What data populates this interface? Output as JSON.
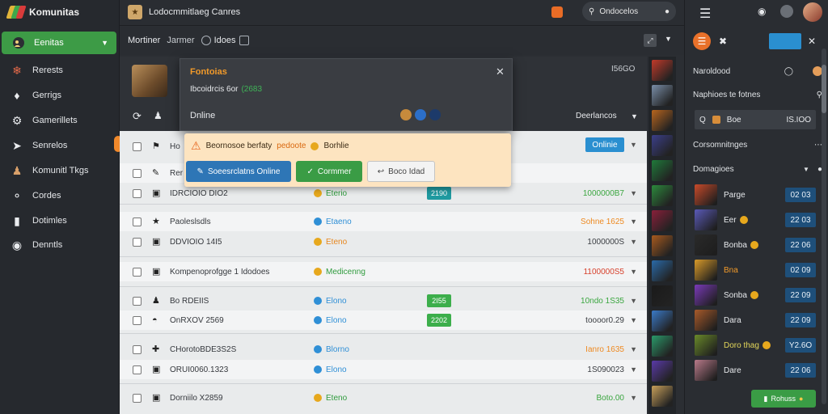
{
  "app": {
    "title": "Komunitas"
  },
  "colors": {
    "accent": "#3d9b46",
    "warning": "#f1892b",
    "link": "#2f8fd6",
    "badge": "#1e4f7a"
  },
  "sidebar": {
    "items": [
      {
        "label": "Eenitas",
        "icon": "games-icon",
        "active": true
      },
      {
        "label": "Rerests",
        "icon": "spark-icon"
      },
      {
        "label": "Gerrigs",
        "icon": "puzzle-icon"
      },
      {
        "label": "Gamerillets",
        "icon": "gear-icon"
      },
      {
        "label": "Senrelos",
        "icon": "rocket-icon"
      },
      {
        "label": "Komunitl Tkgs",
        "icon": "people-icon"
      },
      {
        "label": "Cordes",
        "icon": "link-icon"
      },
      {
        "label": "Dotimles",
        "icon": "chart-icon"
      },
      {
        "label": "Denntls",
        "icon": "discord-icon"
      }
    ]
  },
  "topbar": {
    "title": "Lodocmmitlaeg Canres",
    "search_value": "Ondocelos"
  },
  "subbar": {
    "title": "Mortiner",
    "tab1": "Jarmer",
    "tab2": "Idoes"
  },
  "card": {
    "right_value": "I56GO",
    "right_label": "Deerlancos"
  },
  "modal": {
    "title": "Fontoias",
    "subtitle_prefix": "Ibcoidrcis 6or",
    "subtitle_value": "(2683",
    "status": "Dnline"
  },
  "warning": {
    "text": "Beornosoe berfaty",
    "highlight": "pedoote",
    "trailing": "Borhlie",
    "online_button": "Onlinie",
    "buttons": {
      "primary": "Soeesrclatns Online",
      "confirm": "Cormmer",
      "secondary": "Boco Idad"
    }
  },
  "table": {
    "rows": [
      {
        "name": "Ho",
        "icon": "flag-icon",
        "status": "",
        "value": "",
        "tag": ""
      },
      {
        "name": "Rer",
        "icon": "wrench-icon",
        "status": "",
        "value": "",
        "tag": ""
      },
      {
        "name": "IDRCIOIO DIO2",
        "icon": "",
        "status": "Eterio",
        "status_color": "green",
        "value": "1000000B7",
        "value_color": "green",
        "tag": "2190"
      },
      {
        "name": "Paoleslsdls",
        "icon": "star-icon",
        "status": "Etaeno",
        "status_color": "blue",
        "value": "Sohne 1625",
        "value_color": "orange",
        "tag": ""
      },
      {
        "name": "DDVIOIO 14I5",
        "icon": "",
        "status": "Eteno",
        "status_color": "orange",
        "value": "1000000S",
        "value_color": "dark",
        "tag": ""
      },
      {
        "name": "Kompenoprofgge 1 Idodoes",
        "icon": "",
        "status": "Medicenng",
        "status_color": "green",
        "value": "1100000S5",
        "value_color": "red",
        "tag": ""
      },
      {
        "name": "Bo RDEIIS",
        "icon": "person-icon",
        "status": "Elono",
        "status_color": "blue",
        "value": "10ndo 1S35",
        "value_color": "green",
        "tag": "2I55"
      },
      {
        "name": "OnRXOV 2569",
        "icon": "globe-icon",
        "status": "Elono",
        "status_color": "blue",
        "value": "toooor0.29",
        "value_color": "dark",
        "tag": "2202"
      },
      {
        "name": "CHorotoBDE3S2S",
        "icon": "pin-icon",
        "status": "Blorno",
        "status_color": "blue",
        "value": "Ianro 1635",
        "value_color": "orange",
        "tag": ""
      },
      {
        "name": "ORUI0060.1323",
        "icon": "",
        "status": "Elono",
        "status_color": "blue",
        "value": "1S090023",
        "value_color": "dark",
        "tag": ""
      },
      {
        "name": "Dorniilo X2859",
        "icon": "",
        "status": "Eteno",
        "status_color": "green",
        "value": "Boto.00",
        "value_color": "green",
        "tag": ""
      }
    ]
  },
  "right_panel": {
    "header1": "Naroldood",
    "header2": "Naphioes te fotnes",
    "selected": {
      "name": "Boe",
      "value": "IS.IOO"
    },
    "section1": "Corsomnitnges",
    "section2": "Domagioes",
    "games": [
      {
        "name": "Parge",
        "score": "02 03"
      },
      {
        "name": "Eer",
        "score": "22 03"
      },
      {
        "name": "Bonba",
        "score": "22 06"
      },
      {
        "name": "Bna",
        "score": "02 09",
        "name_color": "orange"
      },
      {
        "name": "Sonba",
        "score": "22 09"
      },
      {
        "name": "Dara",
        "score": "22 09"
      },
      {
        "name": "Doro thag",
        "score": "Y2.6O",
        "name_color": "green"
      },
      {
        "name": "Dare",
        "score": "22 06"
      }
    ],
    "footer_button": "Rohuss"
  }
}
